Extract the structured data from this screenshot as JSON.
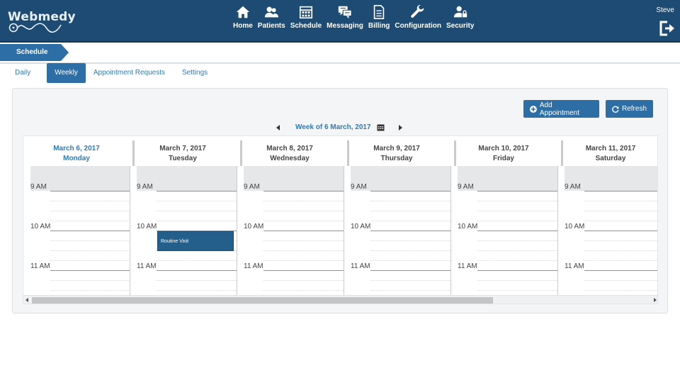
{
  "app": {
    "logo_text": "Webmedy",
    "accent_color": "#1d4b73",
    "link_color": "#2e7bb7"
  },
  "nav": {
    "items": [
      {
        "label": "Home",
        "icon": "home-icon"
      },
      {
        "label": "Patients",
        "icon": "patients-icon"
      },
      {
        "label": "Schedule",
        "icon": "calendar-icon"
      },
      {
        "label": "Messaging",
        "icon": "messaging-icon"
      },
      {
        "label": "Billing",
        "icon": "billing-icon"
      },
      {
        "label": "Configuration",
        "icon": "wrench-icon"
      },
      {
        "label": "Security",
        "icon": "security-icon"
      }
    ],
    "user": "Steve",
    "logout_icon": "logout-icon"
  },
  "breadcrumb": {
    "label": "Schedule"
  },
  "tabs": [
    {
      "label": "Daily",
      "active": false
    },
    {
      "label": "Weekly",
      "active": true
    },
    {
      "label": "Appointment Requests",
      "active": false
    },
    {
      "label": "Settings",
      "active": false
    }
  ],
  "toolbar": {
    "add_label": "Add Appointment",
    "refresh_label": "Refresh"
  },
  "week": {
    "label": "Week of 6 March, 2017"
  },
  "days": [
    {
      "date": "March 6, 2017",
      "name": "Monday",
      "today": true
    },
    {
      "date": "March 7, 2017",
      "name": "Tuesday",
      "today": false
    },
    {
      "date": "March 8, 2017",
      "name": "Wednesday",
      "today": false
    },
    {
      "date": "March 9, 2017",
      "name": "Thursday",
      "today": false
    },
    {
      "date": "March 10, 2017",
      "name": "Friday",
      "today": false
    },
    {
      "date": "March 11, 2017",
      "name": "Saturday",
      "today": false
    }
  ],
  "hours": [
    "9 AM",
    "10 AM",
    "11 AM"
  ],
  "appointments": [
    {
      "day": "March 7, 2017",
      "title": "Routine Visit"
    }
  ]
}
